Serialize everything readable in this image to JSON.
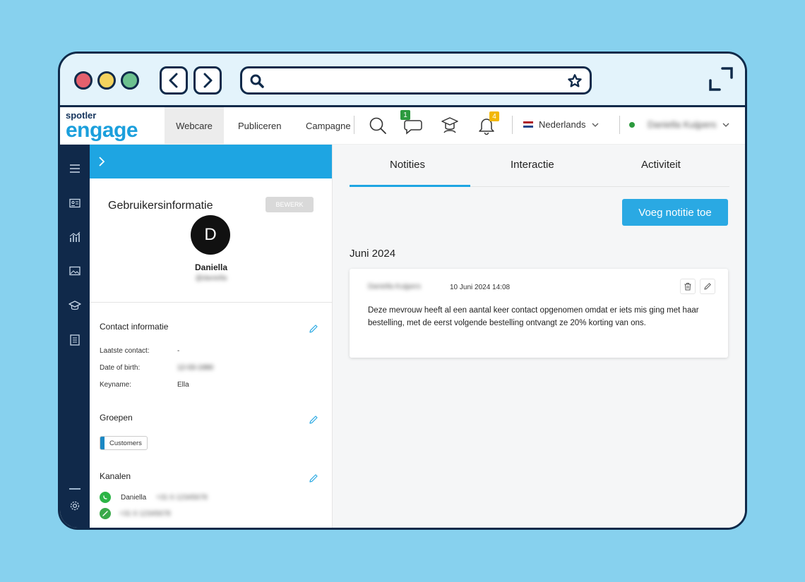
{
  "browser": {
    "icons": [
      "back-arrow-icon",
      "forward-arrow-icon",
      "search-icon",
      "star-icon",
      "expand-icon"
    ]
  },
  "appbar": {
    "logo_small": "spotler",
    "logo_big": "engage",
    "tabs": [
      {
        "label": "Webcare",
        "active": true
      },
      {
        "label": "Publiceren",
        "active": false
      },
      {
        "label": "Campagnes",
        "active": false
      }
    ],
    "chat_badge": "1",
    "notification_badge": "4",
    "language": "Nederlands",
    "user_name": "Daniella Kuijpers"
  },
  "left_panel": {
    "title": "Gebruikersinformatie",
    "edit_label": "BEWERK",
    "avatar_initial": "D",
    "name": "Daniella",
    "subtitle": "@daniella",
    "contact": {
      "title": "Contact informatie",
      "fields": [
        {
          "label": "Laatste contact:",
          "value": "-"
        },
        {
          "label": "Date of birth:",
          "value": "12-03-1990"
        },
        {
          "label": "Keyname:",
          "value": "Ella"
        }
      ]
    },
    "groups": {
      "title": "Groepen",
      "chip": "Customers"
    },
    "channels": {
      "title": "Kanalen",
      "items": [
        {
          "name": "Daniella",
          "value": "+31 6 12345678"
        },
        {
          "name": "",
          "value": "+31 6 12345678"
        }
      ]
    }
  },
  "right_panel": {
    "tabs": [
      "Notities",
      "Interactie",
      "Activiteit"
    ],
    "add_button": "Voeg notitie toe",
    "month": "Juni 2024",
    "note": {
      "author": "Daniella Kuijpers",
      "date": "10 Juni 2024 14:08",
      "text": "Deze mevrouw heeft al een aantal keer contact opgenomen omdat er iets mis ging met haar bestelling, met de eerst volgende bestelling ontvangt ze 20% korting van ons."
    }
  },
  "colors": {
    "frame": "#0f2a4a",
    "accent": "#1ea5e2",
    "rail": "#10294a",
    "background": "#87d1ee"
  }
}
